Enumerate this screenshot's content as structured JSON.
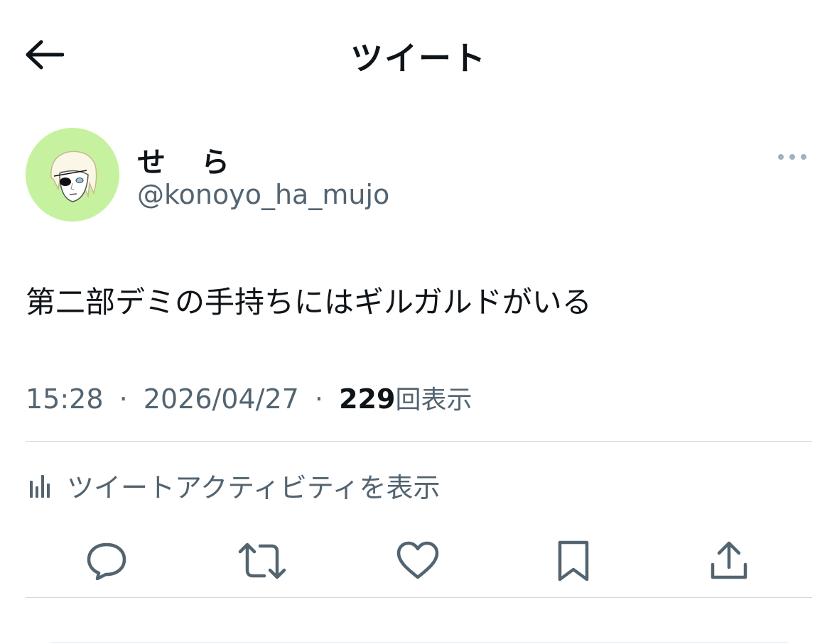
{
  "header": {
    "title": "ツイート"
  },
  "author": {
    "display_name": "せ ら",
    "handle": "@konoyo_ha_mujo"
  },
  "tweet": {
    "text": "第二部デミの手持ちにはギルガルドがいる",
    "time": "15:28",
    "separator": "·",
    "date": "2026/04/27",
    "views_count": "229",
    "views_label": "回表示"
  },
  "activity": {
    "label": "ツイートアクティビティを表示"
  },
  "actions": [
    "reply-icon",
    "retweet-icon",
    "like-icon",
    "bookmark-icon",
    "share-icon"
  ],
  "colors": {
    "text_primary": "#0f1419",
    "text_secondary": "#536471",
    "divider": "#cfd9de",
    "avatar_bg": "#c6f2a0"
  }
}
